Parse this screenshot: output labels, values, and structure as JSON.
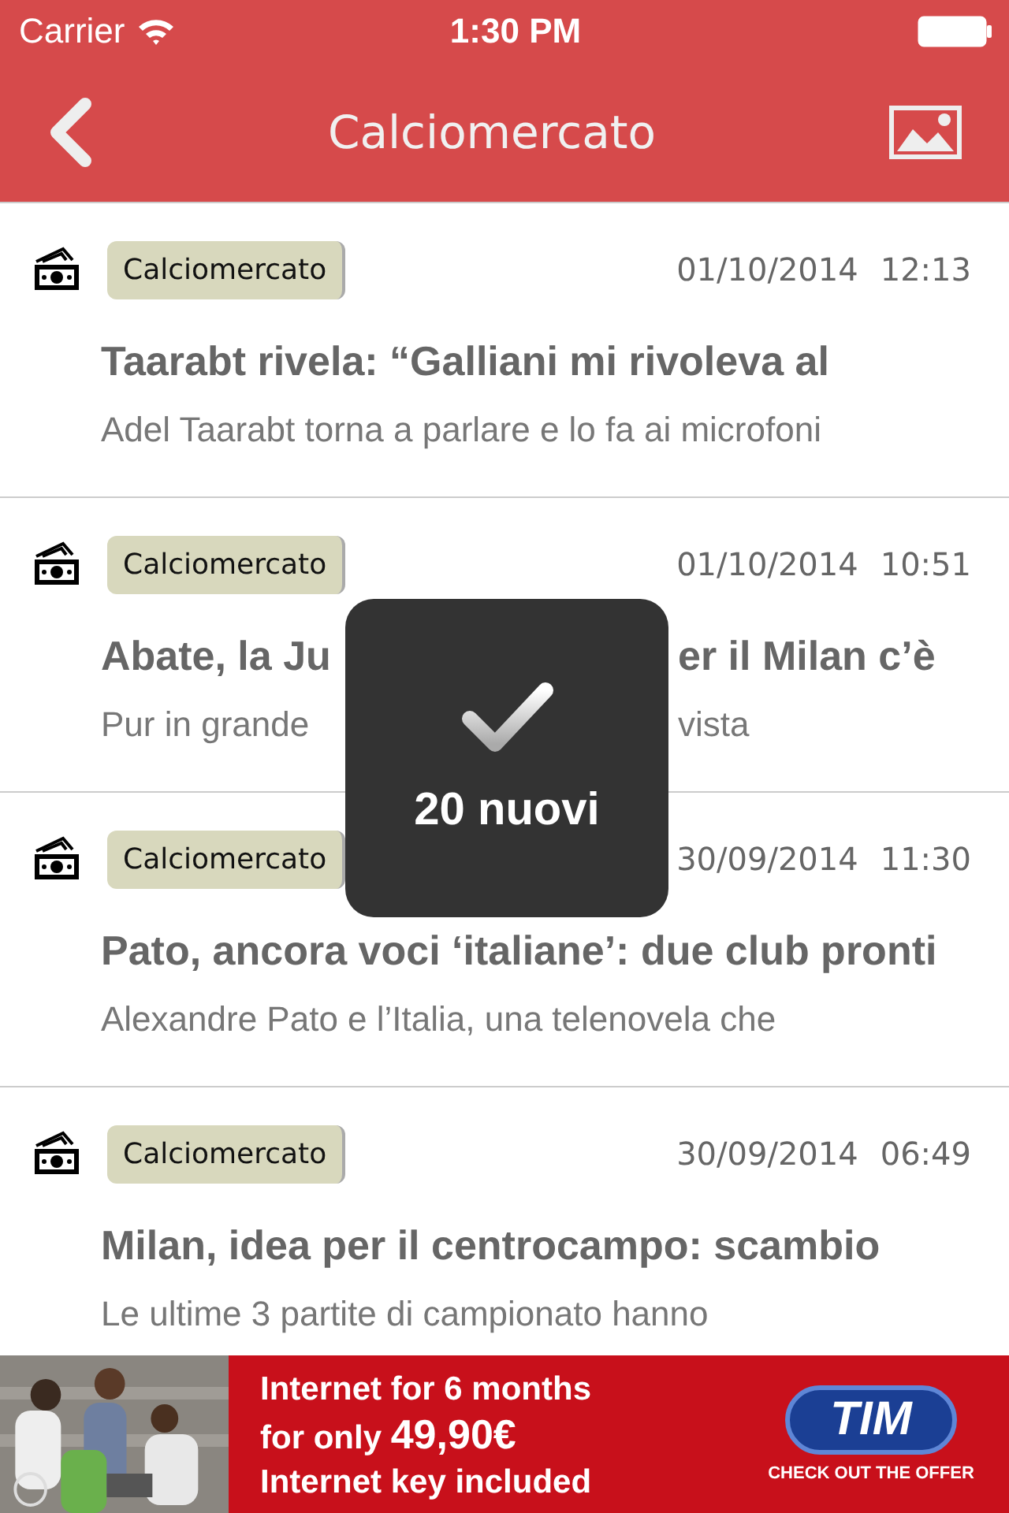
{
  "status_bar": {
    "carrier": "Carrier",
    "time": "1:30 PM"
  },
  "nav": {
    "title": "Calciomercato"
  },
  "articles": [
    {
      "tag": "Calciomercato",
      "date": "01/10/2014",
      "time": "12:13",
      "title": "Taarabt rivela: “Galliani mi rivoleva al",
      "summary": "Adel Taarabt torna a parlare e lo fa ai microfoni"
    },
    {
      "tag": "Calciomercato",
      "date": "01/10/2014",
      "time": "10:51",
      "title_visible": [
        "Abate, la Ju",
        "er il Milan c’è"
      ],
      "summary_visible": [
        "Pur in grande",
        "vista"
      ]
    },
    {
      "tag": "Calciomercato",
      "date": "30/09/2014",
      "time": "11:30",
      "title": "Pato, ancora voci ‘italiane’: due club pronti",
      "summary": "Alexandre Pato e l’Italia, una telenovela che"
    },
    {
      "tag": "Calciomercato",
      "date": "30/09/2014",
      "time": "06:49",
      "title": "Milan, idea per il centrocampo: scambio",
      "summary": "Le ultime 3 partite di campionato hanno"
    }
  ],
  "hud": {
    "message": "20 nuovi"
  },
  "ad": {
    "lines": [
      "Internet for 6 months",
      "for only **49,90€**",
      "Internet key included"
    ],
    "brand": "TIM",
    "cta": "CHECK OUT THE OFFER"
  }
}
